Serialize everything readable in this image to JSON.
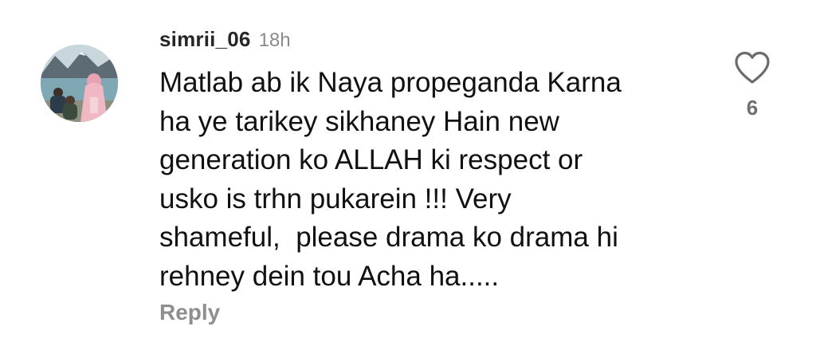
{
  "comment": {
    "username": "simrii_06",
    "timestamp": "18h",
    "text_lines": [
      "Matlab ab ik Naya propeganda Karna",
      "ha ye tarikey sikhaney Hain new",
      "generation ko ALLAH ki respect or",
      "usko is trhn pukarein !!! Very",
      "shameful,  please drama ko drama hi",
      "rehney dein tou Acha ha....."
    ],
    "reply_label": "Reply",
    "like_count": "6",
    "like_icon": "heart-outline-icon"
  },
  "colors": {
    "username": "#262626",
    "timestamp": "#8a8a8a",
    "text": "#111111",
    "reply": "#8e8e8e",
    "like_count": "#707070",
    "heart_stroke": "#6b6b6b"
  }
}
